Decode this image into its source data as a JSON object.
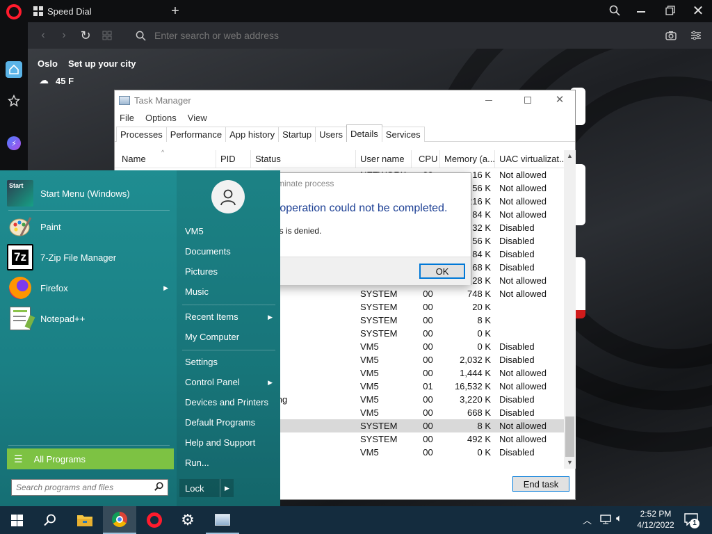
{
  "browser": {
    "tab_title": "Speed Dial",
    "address_placeholder": "Enter search or web address",
    "weather": {
      "city": "Oslo",
      "setup_link": "Set up your city",
      "temperature": "45 F"
    }
  },
  "task_manager": {
    "title": "Task Manager",
    "menu": [
      "File",
      "Options",
      "View"
    ],
    "tabs": [
      "Processes",
      "Performance",
      "App history",
      "Startup",
      "Users",
      "Details",
      "Services"
    ],
    "active_tab": "Details",
    "columns": [
      "Name",
      "PID",
      "Status",
      "User name",
      "CPU",
      "Memory (a...",
      "UAC virtualizat..."
    ],
    "rows": [
      {
        "status": "",
        "user": "NETWORK",
        "cpu": "00",
        "mem": "16 K",
        "uac": "Not allowed"
      },
      {
        "status": "",
        "user": "",
        "cpu": "",
        "mem": "56 K",
        "uac": "Not allowed"
      },
      {
        "status": "",
        "user": "",
        "cpu": "",
        "mem": "216 K",
        "uac": "Not allowed"
      },
      {
        "status": "",
        "user": "",
        "cpu": "",
        "mem": "84 K",
        "uac": "Not allowed"
      },
      {
        "status": "",
        "user": "",
        "cpu": "",
        "mem": "32 K",
        "uac": "Disabled"
      },
      {
        "status": "",
        "user": "",
        "cpu": "",
        "mem": "56 K",
        "uac": "Disabled"
      },
      {
        "status": "",
        "user": "",
        "cpu": "",
        "mem": "84 K",
        "uac": "Disabled"
      },
      {
        "status": "",
        "user": "",
        "cpu": "",
        "mem": "68 K",
        "uac": "Disabled"
      },
      {
        "status": "",
        "user": "",
        "cpu": "",
        "mem": "28 K",
        "uac": "Not allowed"
      },
      {
        "status": "g",
        "user": "SYSTEM",
        "cpu": "00",
        "mem": "748 K",
        "uac": "Not allowed"
      },
      {
        "status": "",
        "user": "SYSTEM",
        "cpu": "00",
        "mem": "20 K",
        "uac": ""
      },
      {
        "status": "g",
        "user": "SYSTEM",
        "cpu": "00",
        "mem": "8 K",
        "uac": ""
      },
      {
        "status": "g",
        "user": "SYSTEM",
        "cpu": "00",
        "mem": "0 K",
        "uac": ""
      },
      {
        "status": "ded",
        "user": "VM5",
        "cpu": "00",
        "mem": "0 K",
        "uac": "Disabled"
      },
      {
        "status": "g",
        "user": "VM5",
        "cpu": "00",
        "mem": "2,032 K",
        "uac": "Disabled"
      },
      {
        "status": "g",
        "user": "VM5",
        "cpu": "00",
        "mem": "1,444 K",
        "uac": "Not allowed"
      },
      {
        "status": "g",
        "user": "VM5",
        "cpu": "01",
        "mem": "16,532 K",
        "uac": "Not allowed"
      },
      {
        "status": "ponding",
        "user": "VM5",
        "cpu": "00",
        "mem": "3,220 K",
        "uac": "Disabled"
      },
      {
        "status": "g",
        "user": "VM5",
        "cpu": "00",
        "mem": "668 K",
        "uac": "Disabled"
      },
      {
        "status": "g",
        "user": "SYSTEM",
        "cpu": "00",
        "mem": "8 K",
        "uac": "Not allowed"
      },
      {
        "status": "g",
        "user": "SYSTEM",
        "cpu": "00",
        "mem": "492 K",
        "uac": "Not allowed"
      },
      {
        "status": "ded",
        "user": "VM5",
        "cpu": "00",
        "mem": "0 K",
        "uac": "Disabled"
      }
    ],
    "selected_row": 19,
    "end_task_label": "End task"
  },
  "error_dialog": {
    "title": "minate process",
    "heading": "e operation could not be completed.",
    "message": "ess is denied.",
    "ok_label": "OK"
  },
  "start_menu": {
    "apps": [
      {
        "label": "Start Menu (Windows)",
        "icon": "start-menu-app-icon"
      },
      {
        "label": "Paint",
        "icon": "paint-palette-icon"
      },
      {
        "label": "7-Zip File Manager",
        "icon": "7zip-icon"
      },
      {
        "label": "Firefox",
        "icon": "firefox-icon",
        "has_submenu": true
      },
      {
        "label": "Notepad++",
        "icon": "notepad-plus-plus-icon"
      }
    ],
    "start_tile_text": "Start",
    "seven_zip_glyph": "7z",
    "user": "VM5",
    "right_items": [
      "Documents",
      "Pictures",
      "Music",
      "Recent Items",
      "My Computer",
      "Settings",
      "Control Panel",
      "Devices and Printers",
      "Default Programs",
      "Help and Support",
      "Run..."
    ],
    "all_programs": "All Programs",
    "search_placeholder": "Search programs and files",
    "lock_label": "Lock"
  },
  "taskbar": {
    "time": "2:52 PM",
    "date": "4/12/2022",
    "notification_count": "1"
  }
}
